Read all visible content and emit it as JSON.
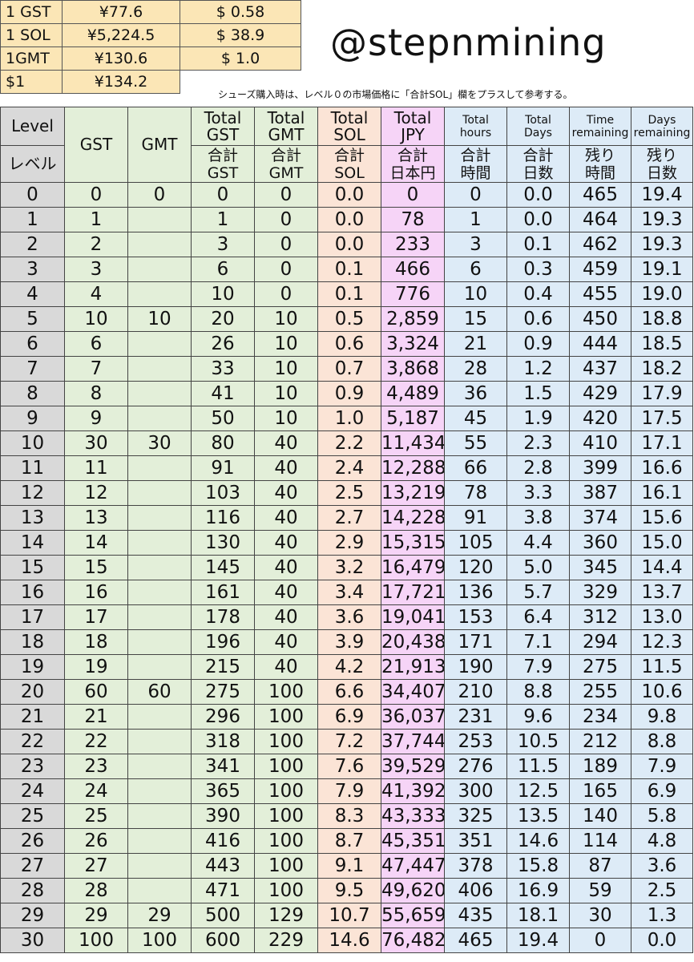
{
  "rates": [
    {
      "label": "1 GST",
      "jpy": "¥77.6",
      "usd": "$ 0.58"
    },
    {
      "label": "1 SOL",
      "jpy": "¥5,224.5",
      "usd": "$ 38.9"
    },
    {
      "label": "1GMT",
      "jpy": "¥130.6",
      "usd": "$ 1.0"
    },
    {
      "label": "$1",
      "jpy": "¥134.2",
      "usd": ""
    }
  ],
  "handle": "@stepnmining",
  "note": "シューズ購入時は、レベル０の市場価格に「合計SOL」欄をプラスして参考する。",
  "headers": {
    "level_en": "Level",
    "level_jp": "レベル",
    "gst": "GST",
    "gmt": "GMT",
    "total_gst_en": "Total\nGST",
    "total_gst_jp": "合計\nGST",
    "total_gmt_en": "Total\nGMT",
    "total_gmt_jp": "合計\nGMT",
    "total_sol_en": "Total\nSOL",
    "total_sol_jp": "合計\nSOL",
    "total_jpy_en": "Total\nJPY",
    "total_jpy_jp": "合計\n日本円",
    "total_hours_en": "Total\nhours",
    "total_hours_jp": "合計\n時間",
    "total_days_en": "Total\nDays",
    "total_days_jp": "合計\n日数",
    "time_rem_en": "Time\nremaining",
    "time_rem_jp": "残り\n時間",
    "days_rem_en": "Days\nremaining",
    "days_rem_jp": "残り\n日数"
  },
  "rows": [
    [
      "0",
      "0",
      "0",
      "0",
      "0",
      "0.0",
      "0",
      "0",
      "0.0",
      "465",
      "19.4"
    ],
    [
      "1",
      "1",
      "",
      "1",
      "0",
      "0.0",
      "78",
      "1",
      "0.0",
      "464",
      "19.3"
    ],
    [
      "2",
      "2",
      "",
      "3",
      "0",
      "0.0",
      "233",
      "3",
      "0.1",
      "462",
      "19.3"
    ],
    [
      "3",
      "3",
      "",
      "6",
      "0",
      "0.1",
      "466",
      "6",
      "0.3",
      "459",
      "19.1"
    ],
    [
      "4",
      "4",
      "",
      "10",
      "0",
      "0.1",
      "776",
      "10",
      "0.4",
      "455",
      "19.0"
    ],
    [
      "5",
      "10",
      "10",
      "20",
      "10",
      "0.5",
      "2,859",
      "15",
      "0.6",
      "450",
      "18.8"
    ],
    [
      "6",
      "6",
      "",
      "26",
      "10",
      "0.6",
      "3,324",
      "21",
      "0.9",
      "444",
      "18.5"
    ],
    [
      "7",
      "7",
      "",
      "33",
      "10",
      "0.7",
      "3,868",
      "28",
      "1.2",
      "437",
      "18.2"
    ],
    [
      "8",
      "8",
      "",
      "41",
      "10",
      "0.9",
      "4,489",
      "36",
      "1.5",
      "429",
      "17.9"
    ],
    [
      "9",
      "9",
      "",
      "50",
      "10",
      "1.0",
      "5,187",
      "45",
      "1.9",
      "420",
      "17.5"
    ],
    [
      "10",
      "30",
      "30",
      "80",
      "40",
      "2.2",
      "11,434",
      "55",
      "2.3",
      "410",
      "17.1"
    ],
    [
      "11",
      "11",
      "",
      "91",
      "40",
      "2.4",
      "12,288",
      "66",
      "2.8",
      "399",
      "16.6"
    ],
    [
      "12",
      "12",
      "",
      "103",
      "40",
      "2.5",
      "13,219",
      "78",
      "3.3",
      "387",
      "16.1"
    ],
    [
      "13",
      "13",
      "",
      "116",
      "40",
      "2.7",
      "14,228",
      "91",
      "3.8",
      "374",
      "15.6"
    ],
    [
      "14",
      "14",
      "",
      "130",
      "40",
      "2.9",
      "15,315",
      "105",
      "4.4",
      "360",
      "15.0"
    ],
    [
      "15",
      "15",
      "",
      "145",
      "40",
      "3.2",
      "16,479",
      "120",
      "5.0",
      "345",
      "14.4"
    ],
    [
      "16",
      "16",
      "",
      "161",
      "40",
      "3.4",
      "17,721",
      "136",
      "5.7",
      "329",
      "13.7"
    ],
    [
      "17",
      "17",
      "",
      "178",
      "40",
      "3.6",
      "19,041",
      "153",
      "6.4",
      "312",
      "13.0"
    ],
    [
      "18",
      "18",
      "",
      "196",
      "40",
      "3.9",
      "20,438",
      "171",
      "7.1",
      "294",
      "12.3"
    ],
    [
      "19",
      "19",
      "",
      "215",
      "40",
      "4.2",
      "21,913",
      "190",
      "7.9",
      "275",
      "11.5"
    ],
    [
      "20",
      "60",
      "60",
      "275",
      "100",
      "6.6",
      "34,407",
      "210",
      "8.8",
      "255",
      "10.6"
    ],
    [
      "21",
      "21",
      "",
      "296",
      "100",
      "6.9",
      "36,037",
      "231",
      "9.6",
      "234",
      "9.8"
    ],
    [
      "22",
      "22",
      "",
      "318",
      "100",
      "7.2",
      "37,744",
      "253",
      "10.5",
      "212",
      "8.8"
    ],
    [
      "23",
      "23",
      "",
      "341",
      "100",
      "7.6",
      "39,529",
      "276",
      "11.5",
      "189",
      "7.9"
    ],
    [
      "24",
      "24",
      "",
      "365",
      "100",
      "7.9",
      "41,392",
      "300",
      "12.5",
      "165",
      "6.9"
    ],
    [
      "25",
      "25",
      "",
      "390",
      "100",
      "8.3",
      "43,333",
      "325",
      "13.5",
      "140",
      "5.8"
    ],
    [
      "26",
      "26",
      "",
      "416",
      "100",
      "8.7",
      "45,351",
      "351",
      "14.6",
      "114",
      "4.8"
    ],
    [
      "27",
      "27",
      "",
      "443",
      "100",
      "9.1",
      "47,447",
      "378",
      "15.8",
      "87",
      "3.6"
    ],
    [
      "28",
      "28",
      "",
      "471",
      "100",
      "9.5",
      "49,620",
      "406",
      "16.9",
      "59",
      "2.5"
    ],
    [
      "29",
      "29",
      "29",
      "500",
      "129",
      "10.7",
      "55,659",
      "435",
      "18.1",
      "30",
      "1.3"
    ],
    [
      "30",
      "100",
      "100",
      "600",
      "229",
      "14.6",
      "76,482",
      "465",
      "19.4",
      "0",
      "0.0"
    ]
  ]
}
